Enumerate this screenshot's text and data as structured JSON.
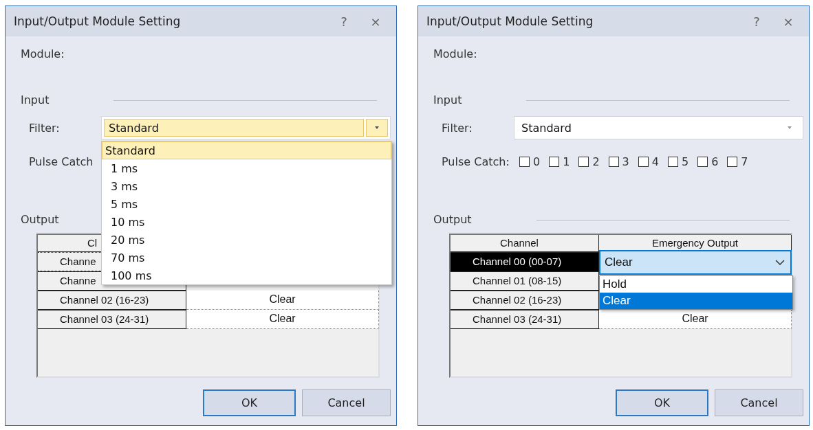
{
  "dialogs": [
    {
      "title": "Input/Output Module Setting",
      "help_button": "?",
      "close_button": "×",
      "module_label": "Module:",
      "input_label": "Input",
      "filter": {
        "label": "Filter:",
        "value": "Standard",
        "highlighted": true,
        "options": [
          {
            "label": "Standard",
            "selected": true
          },
          {
            "label": "1 ms",
            "selected": false
          },
          {
            "label": "3 ms",
            "selected": false
          },
          {
            "label": "5 ms",
            "selected": false
          },
          {
            "label": "10 ms",
            "selected": false
          },
          {
            "label": "20 ms",
            "selected": false
          },
          {
            "label": "70 ms",
            "selected": false
          },
          {
            "label": "100 ms",
            "selected": false
          }
        ]
      },
      "pulse_catch": {
        "label": "Pulse Catch"
      },
      "output_label": "Output",
      "table": {
        "columns": [
          "Cl"
        ],
        "rows": [
          {
            "channel": "Channe",
            "selected": false,
            "focused": true
          },
          {
            "channel": "Channe",
            "selected": false,
            "focused": false
          },
          {
            "channel": "Channel 02 (16-23)",
            "output": "Clear",
            "selected": false,
            "focused": false
          },
          {
            "channel": "Channel 03 (24-31)",
            "output": "Clear",
            "selected": false,
            "focused": false
          }
        ]
      },
      "buttons": [
        {
          "label": "OK",
          "default": true
        },
        {
          "label": "Cancel",
          "default": false
        }
      ]
    },
    {
      "title": "Input/Output Module Setting",
      "help_button": "?",
      "close_button": "×",
      "module_label": "Module:",
      "input_label": "Input",
      "filter": {
        "label": "Filter:",
        "value": "Standard",
        "highlighted": false
      },
      "pulse_catch": {
        "label": "Pulse Catch:",
        "checkboxes": [
          {
            "label": "0",
            "checked": false
          },
          {
            "label": "1",
            "checked": false
          },
          {
            "label": "2",
            "checked": false
          },
          {
            "label": "3",
            "checked": false
          },
          {
            "label": "4",
            "checked": false
          },
          {
            "label": "5",
            "checked": false
          },
          {
            "label": "6",
            "checked": false
          },
          {
            "label": "7",
            "checked": false
          }
        ]
      },
      "output_label": "Output",
      "table": {
        "columns": [
          "Channel",
          "Emergency Output"
        ],
        "rows": [
          {
            "channel": "Channel 00 (00-07)",
            "selected": true,
            "focused": false,
            "editor": {
              "value": "Clear",
              "options": [
                {
                  "label": "Hold",
                  "selected": false
                },
                {
                  "label": "Clear",
                  "selected": true
                }
              ]
            }
          },
          {
            "channel": "Channel 01 (08-15)",
            "selected": false,
            "focused": false
          },
          {
            "channel": "Channel 02 (16-23)",
            "selected": false,
            "focused": false
          },
          {
            "channel": "Channel 03 (24-31)",
            "output": "Clear",
            "selected": false,
            "focused": false
          }
        ]
      },
      "buttons": [
        {
          "label": "OK",
          "default": true
        },
        {
          "label": "Cancel",
          "default": false
        }
      ]
    }
  ]
}
